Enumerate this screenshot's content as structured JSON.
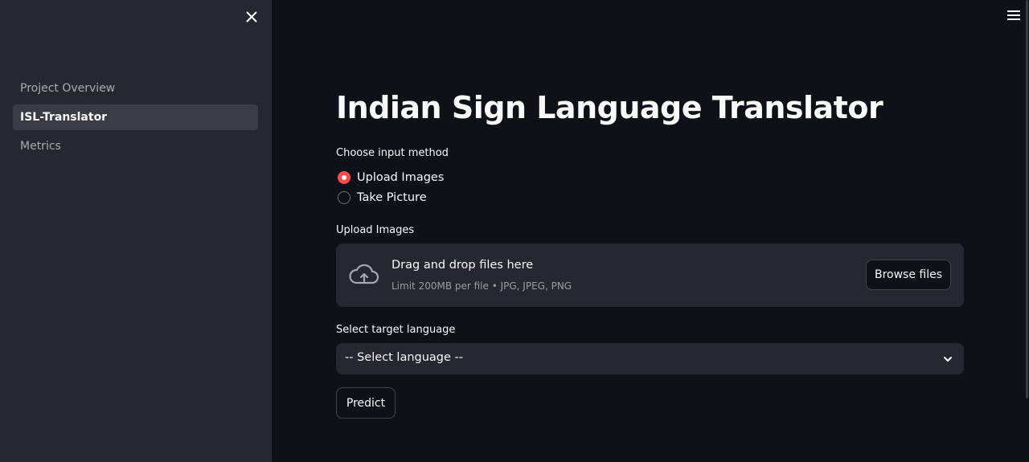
{
  "sidebar": {
    "close_icon": "close-icon",
    "items": [
      {
        "label": "Project Overview",
        "active": false
      },
      {
        "label": "ISL-Translator",
        "active": true
      },
      {
        "label": "Metrics",
        "active": false
      }
    ]
  },
  "header": {
    "menu_icon": "hamburger-menu-icon"
  },
  "main": {
    "title": "Indian Sign Language Translator",
    "input_method": {
      "label": "Choose input method",
      "options": [
        {
          "label": "Upload Images",
          "selected": true
        },
        {
          "label": "Take Picture",
          "selected": false
        }
      ]
    },
    "uploader": {
      "label": "Upload Images",
      "drop_title": "Drag and drop files here",
      "drop_limit": "Limit 200MB per file • JPG, JPEG, PNG",
      "browse_label": "Browse files",
      "icon": "cloud-upload-icon"
    },
    "language": {
      "label": "Select target language",
      "selected": "-- Select language --",
      "icon": "chevron-down-icon"
    },
    "predict_label": "Predict"
  },
  "colors": {
    "background": "#0e1117",
    "sidebar": "#262730",
    "accent": "#ff4b4b",
    "text": "#fafafa"
  }
}
